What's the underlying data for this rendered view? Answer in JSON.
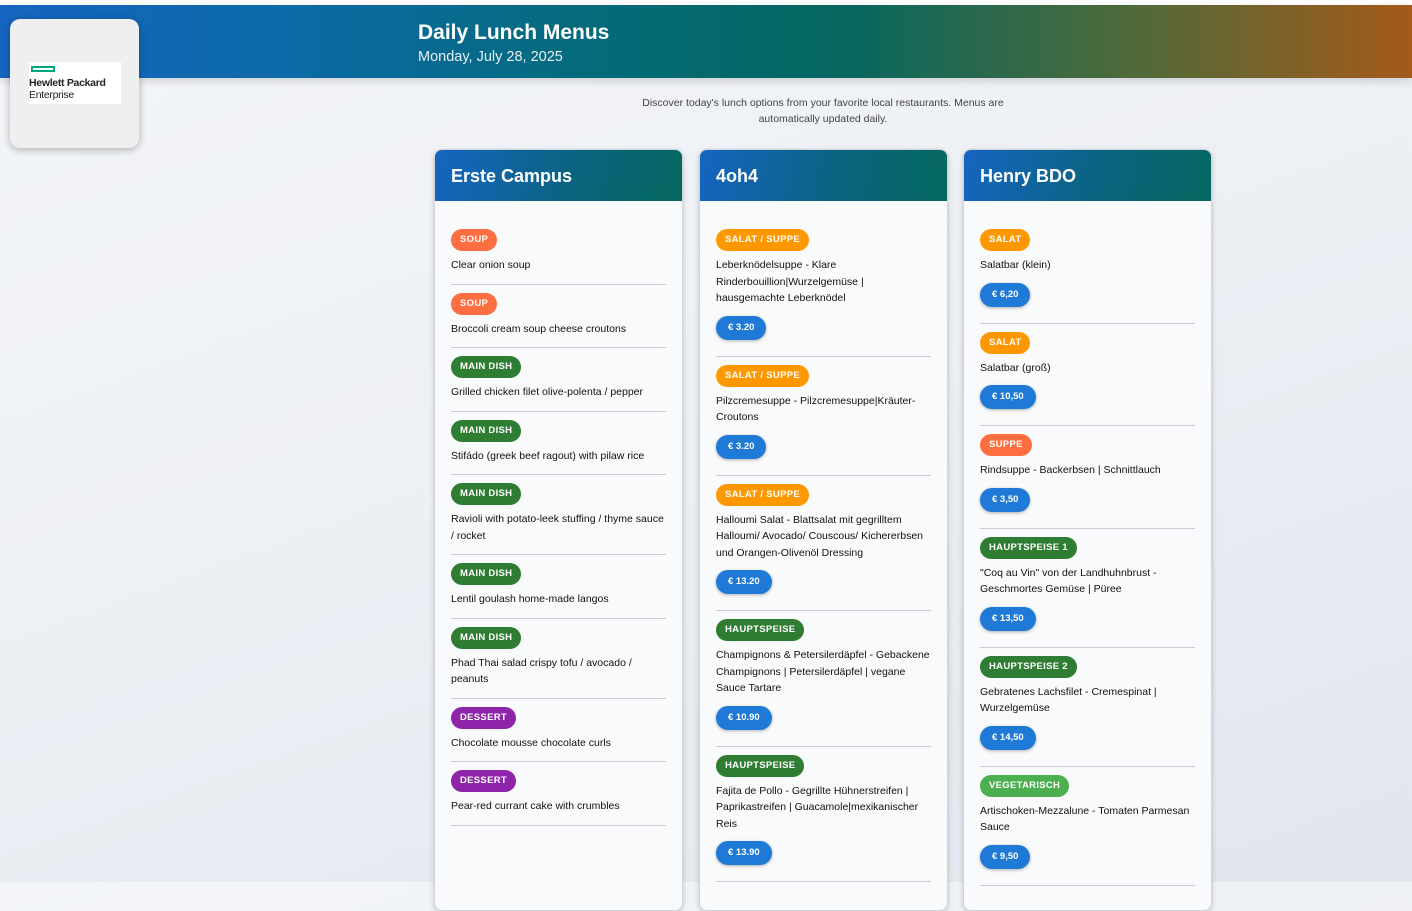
{
  "header": {
    "title": "Daily Lunch Menus",
    "date": "Monday, July 28, 2025"
  },
  "logo": {
    "line1": "Hewlett Packard",
    "line2": "Enterprise",
    "icon": "hpe-rectangle-logo-icon"
  },
  "intro": "Discover today's lunch options from your favorite local restaurants. Menus are automatically updated daily.",
  "colors": {
    "soup": "#ff6e40",
    "main": "#2e7d32",
    "dessert": "#8e24aa",
    "salat": "#ff9800",
    "veg": "#4caf50",
    "price": "#1e7ad6"
  },
  "restaurants": [
    {
      "name": "Erste Campus",
      "items": [
        {
          "category": "SOUP",
          "name": "Clear onion soup"
        },
        {
          "category": "SOUP",
          "name": "Broccoli cream soup cheese croutons"
        },
        {
          "category": "MAIN DISH",
          "name": "Grilled chicken filet olive-polenta / pepper"
        },
        {
          "category": "MAIN DISH",
          "name": "Stifádo (greek beef ragout) with pilaw rice"
        },
        {
          "category": "MAIN DISH",
          "name": "Ravioli with potato-leek stuffing / thyme sauce / rocket"
        },
        {
          "category": "MAIN DISH",
          "name": "Lentil goulash home-made langos"
        },
        {
          "category": "MAIN DISH",
          "name": "Phad Thai salad crispy tofu / avocado / peanuts"
        },
        {
          "category": "DESSERT",
          "name": "Chocolate mousse chocolate curls"
        },
        {
          "category": "DESSERT",
          "name": "Pear-red currant cake with crumbles"
        }
      ]
    },
    {
      "name": "4oh4",
      "items": [
        {
          "category": "SALAT / SUPPE",
          "name": "Leberknödelsuppe - Klare Rinderbouillion|Wurzelgemüse | hausgemachte Leberknödel",
          "price": "€ 3.20"
        },
        {
          "category": "SALAT / SUPPE",
          "name": "Pilzcremesuppe - Pilzcremesuppe|Kräuter-Croutons",
          "price": "€ 3.20"
        },
        {
          "category": "SALAT / SUPPE",
          "name": "Halloumi Salat - Blattsalat mit gegrilltem Halloumi/ Avocado/ Couscous/ Kichererbsen und Orangen-Olivenöl Dressing",
          "price": "€ 13.20"
        },
        {
          "category": "HAUPTSPEISE",
          "name": "Champignons & Petersilerdäpfel - Gebackene Champignons | Petersilerdäpfel | vegane Sauce Tartare",
          "price": "€ 10.90"
        },
        {
          "category": "HAUPTSPEISE",
          "name": "Fajita de Pollo - Gegrillte Hühnerstreifen | Paprikastreifen | Guacamole|mexikanischer Reis",
          "price": "€ 13.90"
        }
      ]
    },
    {
      "name": "Henry BDO",
      "items": [
        {
          "category": "SALAT",
          "name": "Salatbar (klein)",
          "price": "€ 6,20"
        },
        {
          "category": "SALAT",
          "name": "Salatbar (groß)",
          "price": "€ 10,50"
        },
        {
          "category": "SUPPE",
          "name": "Rindsuppe - Backerbsen | Schnittlauch",
          "price": "€ 3,50"
        },
        {
          "category": "HAUPTSPEISE 1",
          "name": "\"Coq au Vin\" von der Landhuhnbrust - Geschmortes Gemüse | Püree",
          "price": "€ 13,50"
        },
        {
          "category": "HAUPTSPEISE 2",
          "name": "Gebratenes Lachsfilet - Cremespinat | Wurzelgemüse",
          "price": "€ 14,50"
        },
        {
          "category": "VEGETARISCH",
          "name": "Artischoken-Mezzalune - Tomaten Parmesan Sauce",
          "price": "€ 9,50"
        }
      ]
    }
  ]
}
